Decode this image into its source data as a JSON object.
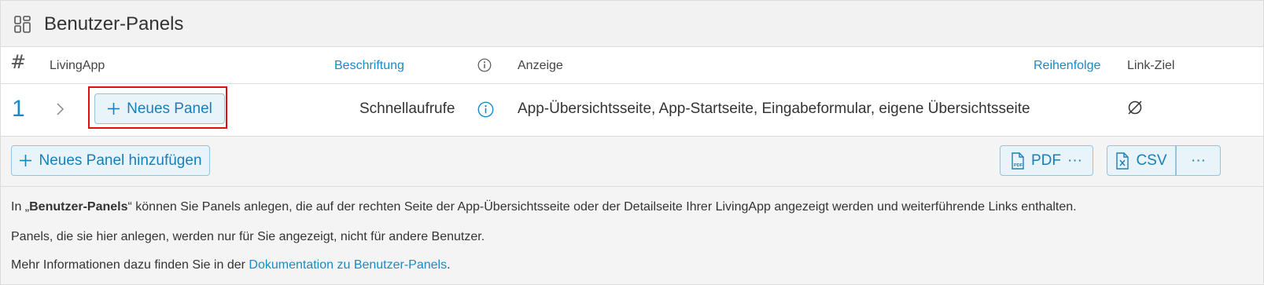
{
  "header": {
    "title": "Benutzer-Panels",
    "icon": "grid-icon"
  },
  "table": {
    "columns": {
      "hash": "#",
      "livingapp": "LivingApp",
      "caption": "Beschriftung",
      "display": "Anzeige",
      "order": "Reihenfolge",
      "link_target": "Link-Ziel"
    },
    "rows": [
      {
        "number": "1",
        "livingapp_button": "Neues Panel",
        "caption": "Schnellaufrufe",
        "display": "App-Übersichtsseite, App-Startseite, Eingabeformular, eigene Übersichtsseite",
        "link_target_symbol": "∅"
      }
    ]
  },
  "toolbar": {
    "add_label": "Neues Panel hinzufügen",
    "pdf_label": "PDF",
    "pdf_more": "···",
    "csv_label": "CSV",
    "more_label": "···"
  },
  "description": {
    "line1_prefix": "In „",
    "line1_bold": "Benutzer-Panels",
    "line1_suffix": "“ können Sie Panels anlegen, die auf der rechten Seite der App-Übersichtsseite oder der Detailseite Ihrer LivingApp angezeigt werden und weiterführende Links enthalten.",
    "line2": "Panels, die sie hier anlegen, werden nur für Sie angezeigt, nicht für andere Benutzer.",
    "line3_prefix": "Mehr Informationen dazu finden Sie in der ",
    "line3_link": "Dokumentation zu Benutzer-Panels",
    "line3_suffix": "."
  },
  "colors": {
    "accent": "#1a8ac6",
    "button_bg": "#e8f3fa",
    "button_border": "#8fc4e3",
    "highlight": "#e01010"
  }
}
